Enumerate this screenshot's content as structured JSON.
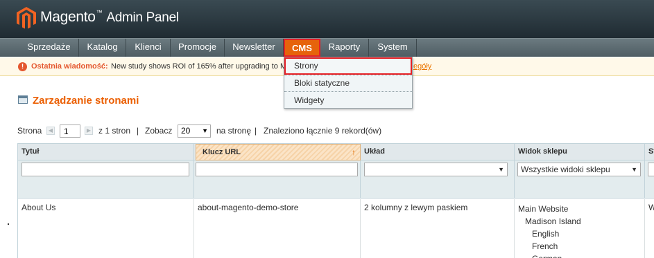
{
  "app": {
    "logo_text": "Magento",
    "logo_tm": "™",
    "logo_sub": "Admin Panel"
  },
  "nav": {
    "items": [
      {
        "label": "Sprzedaże"
      },
      {
        "label": "Katalog"
      },
      {
        "label": "Klienci"
      },
      {
        "label": "Promocje"
      },
      {
        "label": "Newsletter"
      },
      {
        "label": "CMS",
        "active": true
      },
      {
        "label": "Raporty"
      },
      {
        "label": "System"
      }
    ]
  },
  "message": {
    "strong": "Ostatnia wiadomość:",
    "text": "New study shows ROI of 165% after upgrading to M",
    "link": "egóły"
  },
  "cms_menu": {
    "items": [
      {
        "label": "Strony",
        "highlighted": true
      },
      {
        "label": "Bloki statyczne"
      },
      {
        "label": "Widgety"
      }
    ]
  },
  "page": {
    "title": "Zarządzanie stronami",
    "title_icon": "grid-icon"
  },
  "pager": {
    "page_label": "Strona",
    "page_value": "1",
    "of_text": "z 1 stron",
    "sep1": "|",
    "view_label": "Zobacz",
    "per_page": "20",
    "per_page_suffix": "na stronę",
    "sep2": "|",
    "found_text": "Znaleziono łącznie 9 rekord(ów)"
  },
  "grid": {
    "columns": [
      "Tytuł",
      "Klucz URL",
      "Układ",
      "Widok sklepu",
      "St"
    ],
    "sorted_column": "Klucz URL",
    "filters": {
      "title": "",
      "url_key": "",
      "layout": "",
      "store_view": "Wszystkie widoki sklepu"
    },
    "rows": [
      {
        "title": "About Us",
        "url_key": "about-magento-demo-store",
        "layout": "2 kolumny z lewym paskiem",
        "store_view": [
          "Main Website",
          "Madison Island",
          "English",
          "French",
          "German"
        ],
        "status": "W"
      }
    ]
  },
  "colors": {
    "accent": "#eb5e00",
    "active_tab": "#e6630b",
    "highlight_border": "#e62026"
  }
}
